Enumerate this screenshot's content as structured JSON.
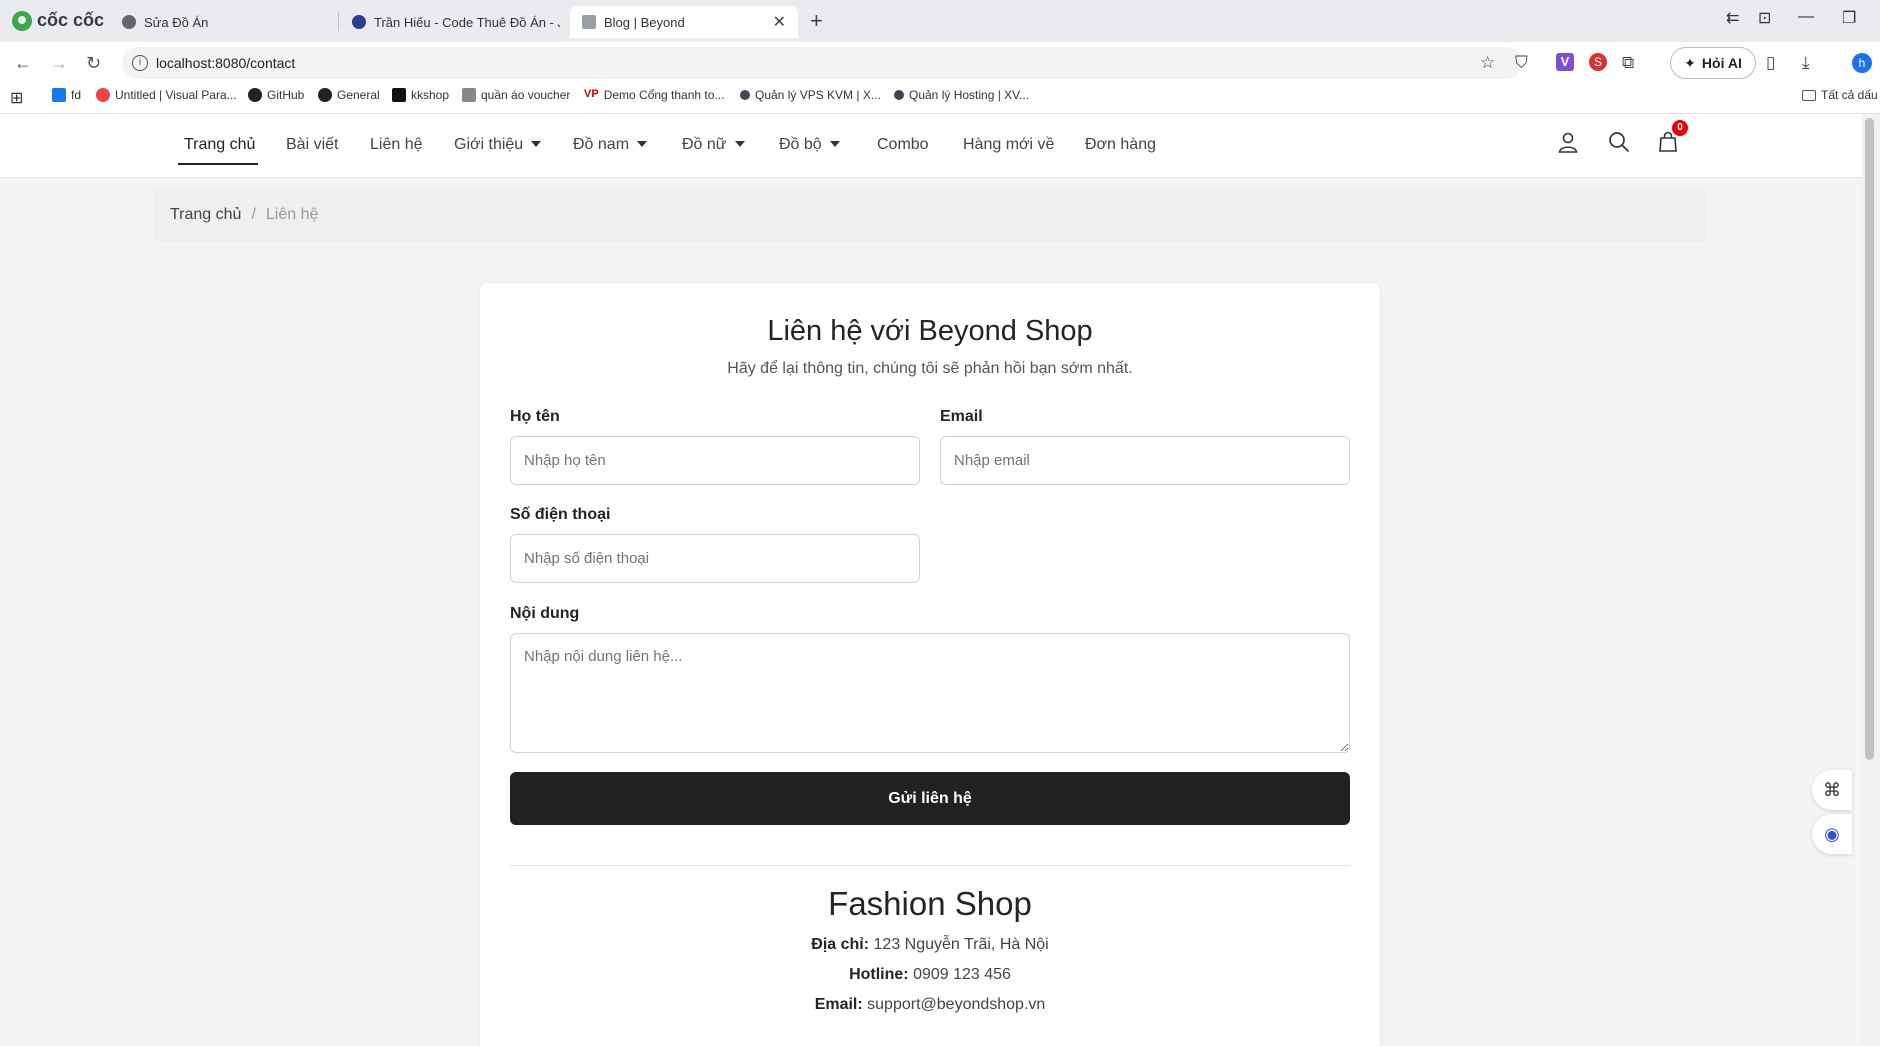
{
  "browser": {
    "brand": "cốc cốc",
    "tabs": [
      {
        "title": "Sửa Đồ Án"
      },
      {
        "title": "Trần Hiếu - Code Thuê Đồ Án - J"
      },
      {
        "title": "Blog | Beyond"
      }
    ],
    "url": "localhost:8080/contact",
    "hoi_ai": "Hỏi AI",
    "profile_initial": "h",
    "bookmarks": [
      {
        "label": "fd",
        "icon": "facebook-icon"
      },
      {
        "label": "Untitled | Visual Para...",
        "icon": "visual-paradigm-icon"
      },
      {
        "label": "GitHub",
        "icon": "github-icon"
      },
      {
        "label": "General",
        "icon": "github-icon"
      },
      {
        "label": "kkshop",
        "icon": "kkshop-icon"
      },
      {
        "label": "quần áo voucher",
        "icon": "shop-icon"
      },
      {
        "label": "Demo Cổng thanh to...",
        "icon": "vp-icon"
      },
      {
        "label": "Quản lý VPS KVM | X...",
        "icon": "user-icon"
      },
      {
        "label": "Quản lý Hosting | XV...",
        "icon": "user-icon"
      }
    ],
    "all_bookmarks": "Tất cả dấu"
  },
  "nav": {
    "items": [
      {
        "label": "Trang chủ"
      },
      {
        "label": "Bài viết"
      },
      {
        "label": "Liên hệ"
      },
      {
        "label": "Giới thiệu"
      },
      {
        "label": "Đồ nam"
      },
      {
        "label": "Đồ nữ"
      },
      {
        "label": "Đồ bộ"
      },
      {
        "label": "Combo"
      },
      {
        "label": "Hàng mới về"
      },
      {
        "label": "Đơn hàng"
      }
    ],
    "cart_count": "0"
  },
  "breadcrumb": {
    "home": "Trang chủ",
    "separator": "/",
    "current": "Liên hệ"
  },
  "contact": {
    "title": "Liên hệ với Beyond Shop",
    "subtitle": "Hãy để lại thông tin, chúng tôi sẽ phản hồi bạn sớm nhất.",
    "name_label": "Họ tên",
    "name_placeholder": "Nhập họ tên",
    "email_label": "Email",
    "email_placeholder": "Nhập email",
    "phone_label": "Số điện thoại",
    "phone_placeholder": "Nhập số điện thoại",
    "message_label": "Nội dung",
    "message_placeholder": "Nhập nội dung liên hệ...",
    "submit_label": "Gửi liên hệ"
  },
  "shop_info": {
    "name": "Fashion Shop",
    "address_label": "Địa chỉ:",
    "address": "123 Nguyễn Trãi, Hà Nội",
    "hotline_label": "Hotline:",
    "hotline": "0909 123 456",
    "email_label": "Email:",
    "email": "support@beyondshop.vn"
  },
  "colors": {
    "accent": "#212121",
    "badge": "#e00000",
    "page_bg": "#f4f4f5"
  }
}
